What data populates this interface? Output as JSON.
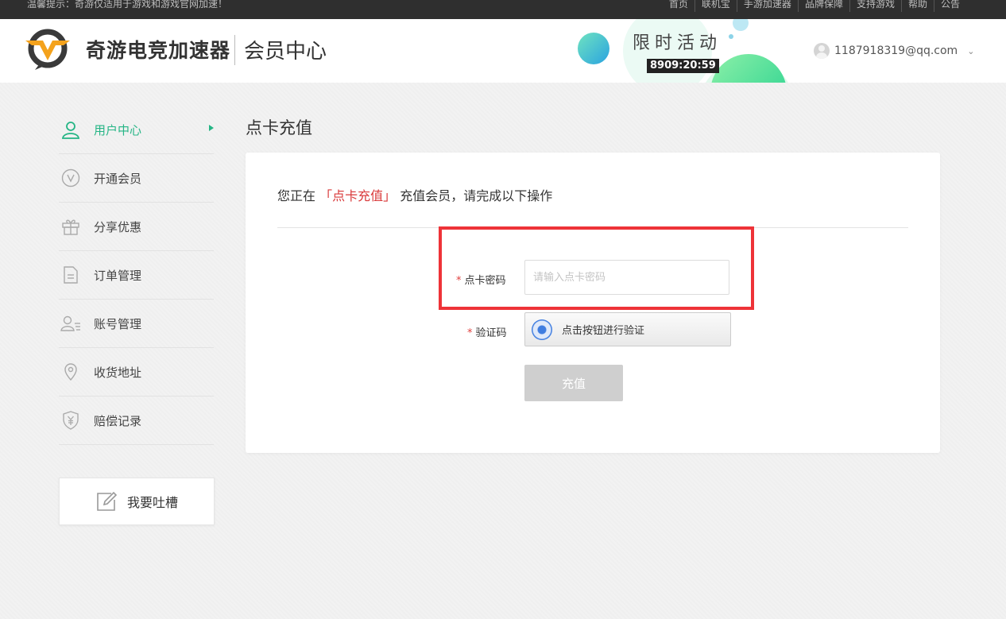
{
  "topbar": {
    "notice": "温馨提示：奇游仅适用于游戏和游戏官网加速！",
    "links": [
      "首页",
      "联机宝",
      "手游加速器",
      "品牌保障",
      "支持游戏",
      "帮助",
      "公告"
    ]
  },
  "header": {
    "brand": "奇游电竞加速器",
    "section": "会员中心",
    "promo_title": "限时活动",
    "promo_timer": "8909:20:59",
    "user_email": "1187918319@qq.com"
  },
  "sidebar": {
    "items": [
      {
        "label": "用户中心",
        "icon": "user-icon",
        "active": true
      },
      {
        "label": "开通会员",
        "icon": "vip-icon",
        "active": false
      },
      {
        "label": "分享优惠",
        "icon": "gift-icon",
        "active": false
      },
      {
        "label": "订单管理",
        "icon": "document-icon",
        "active": false
      },
      {
        "label": "账号管理",
        "icon": "account-list-icon",
        "active": false
      },
      {
        "label": "收货地址",
        "icon": "location-icon",
        "active": false
      },
      {
        "label": "赔偿记录",
        "icon": "shield-yen-icon",
        "active": false
      }
    ],
    "feedback_label": "我要吐槽"
  },
  "main": {
    "page_title": "点卡充值",
    "intro_prefix": "您正在",
    "intro_highlight": "「点卡充值」",
    "intro_suffix": "充值会员，请完成以下操作",
    "form": {
      "required_mark": "*",
      "card_password_label": "点卡密码",
      "card_password_placeholder": "请输入点卡密码",
      "card_password_value": "",
      "captcha_label": "验证码",
      "captcha_button": "点击按钮进行验证",
      "submit_label": "充值"
    }
  },
  "colors": {
    "accent_green": "#25b585",
    "highlight_red": "#d9393a",
    "annotation_red": "#ee3338"
  }
}
